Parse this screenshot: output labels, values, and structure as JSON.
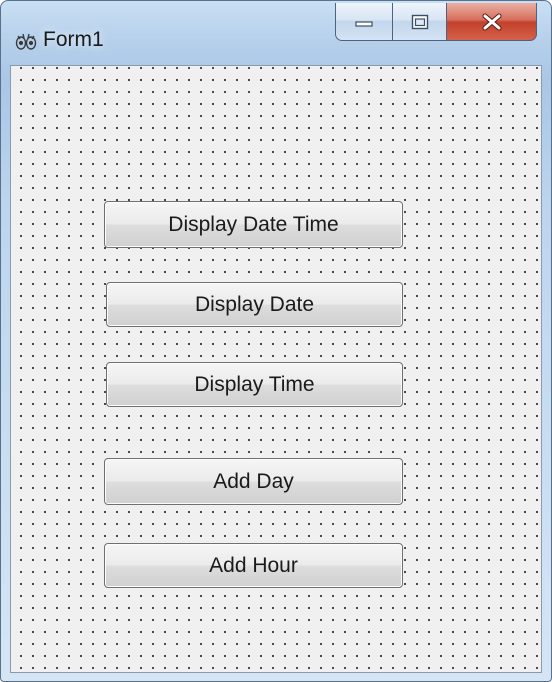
{
  "window": {
    "title": "Form1",
    "app_icon": "lazarus-paw-icon"
  },
  "caption_buttons": {
    "minimize_icon": "minimize-icon",
    "maximize_icon": "maximize-icon",
    "close_icon": "close-icon"
  },
  "form": {
    "grid": "dotted-design-grid",
    "buttons": {
      "display_date_time": "Display Date Time",
      "display_date": "Display Date",
      "display_time": "Display Time",
      "add_day": "Add Day",
      "add_hour": "Add Hour"
    }
  }
}
